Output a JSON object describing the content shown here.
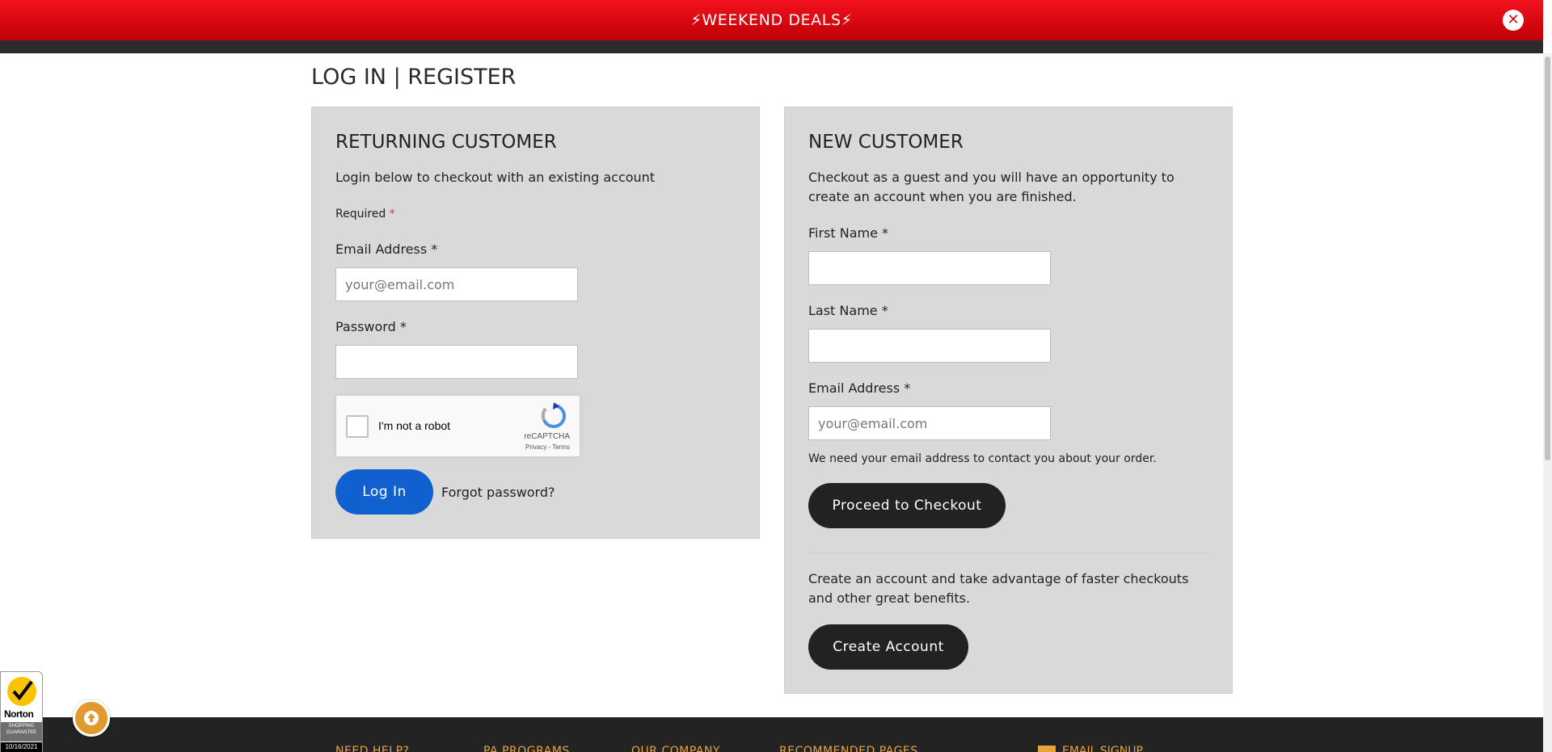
{
  "promo": {
    "text": "⚡WEEKEND DEALS⚡",
    "close_icon": "close-icon"
  },
  "page": {
    "title": "LOG IN | REGISTER"
  },
  "returning": {
    "heading": "RETURNING CUSTOMER",
    "intro": "Login below to checkout with an existing account",
    "required_label": "Required",
    "required_star": "*",
    "email_label": "Email Address *",
    "email_placeholder": "your@email.com",
    "password_label": "Password *",
    "login_button": "Log In",
    "forgot_link": "Forgot password?"
  },
  "recaptcha": {
    "label": "I'm not a robot",
    "brand": "reCAPTCHA",
    "terms": "Privacy - Terms"
  },
  "new_customer": {
    "heading": "NEW CUSTOMER",
    "intro": "Checkout as a guest and you will have an opportunity to create an account when you are finished.",
    "first_name_label": "First Name *",
    "last_name_label": "Last Name *",
    "email_label": "Email Address *",
    "email_placeholder": "your@email.com",
    "email_note": "We need your email address to contact you about your order.",
    "checkout_button": "Proceed to Checkout",
    "create_text": "Create an account and take advantage of faster checkouts and other great benefits.",
    "create_button": "Create Account"
  },
  "footer": {
    "columns": [
      "NEED HELP?",
      "PA PROGRAMS",
      "OUR COMPANY",
      "RECOMMENDED PAGES"
    ],
    "email_signup": "EMAIL SIGNUP"
  },
  "norton": {
    "name": "Norton",
    "guarantee": "SHOPPING GUARANTEE",
    "date": "10/16/2021"
  },
  "colors": {
    "promo_red": "#e30613",
    "login_blue": "#1160d0",
    "dark_button": "#222222",
    "footer_accent": "#e8a33d",
    "back_to_top": "#e39a2c"
  }
}
